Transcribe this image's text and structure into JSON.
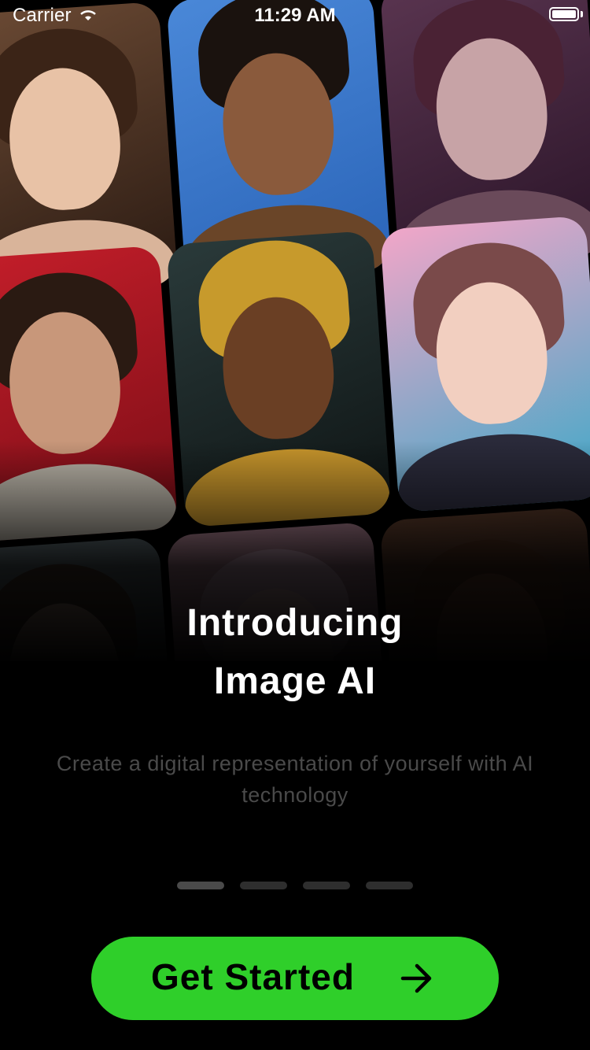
{
  "status_bar": {
    "carrier": "Carrier",
    "time": "11:29 AM",
    "icons": [
      "wifi-icon",
      "battery-icon"
    ]
  },
  "collage": {
    "tiles": [
      {
        "name": "portrait-young-man-curly-hair"
      },
      {
        "name": "portrait-man-beard-blue-background"
      },
      {
        "name": "portrait-fantasy-woman-purple"
      },
      {
        "name": "portrait-man-red-background"
      },
      {
        "name": "portrait-egyptian-queen"
      },
      {
        "name": "portrait-anime-woman-pink"
      },
      {
        "name": "portrait-person-teal"
      },
      {
        "name": "portrait-person-pink-hair"
      },
      {
        "name": "portrait-bald-man"
      }
    ]
  },
  "onboarding": {
    "title_line1": "Introducing",
    "title_line2": "Image AI",
    "subtitle": "Create a digital representation of yourself with AI technology",
    "pages": 4,
    "active_page": 1
  },
  "cta": {
    "label": "Get Started",
    "icon": "arrow-right-icon",
    "color": "#2fcf2a"
  }
}
